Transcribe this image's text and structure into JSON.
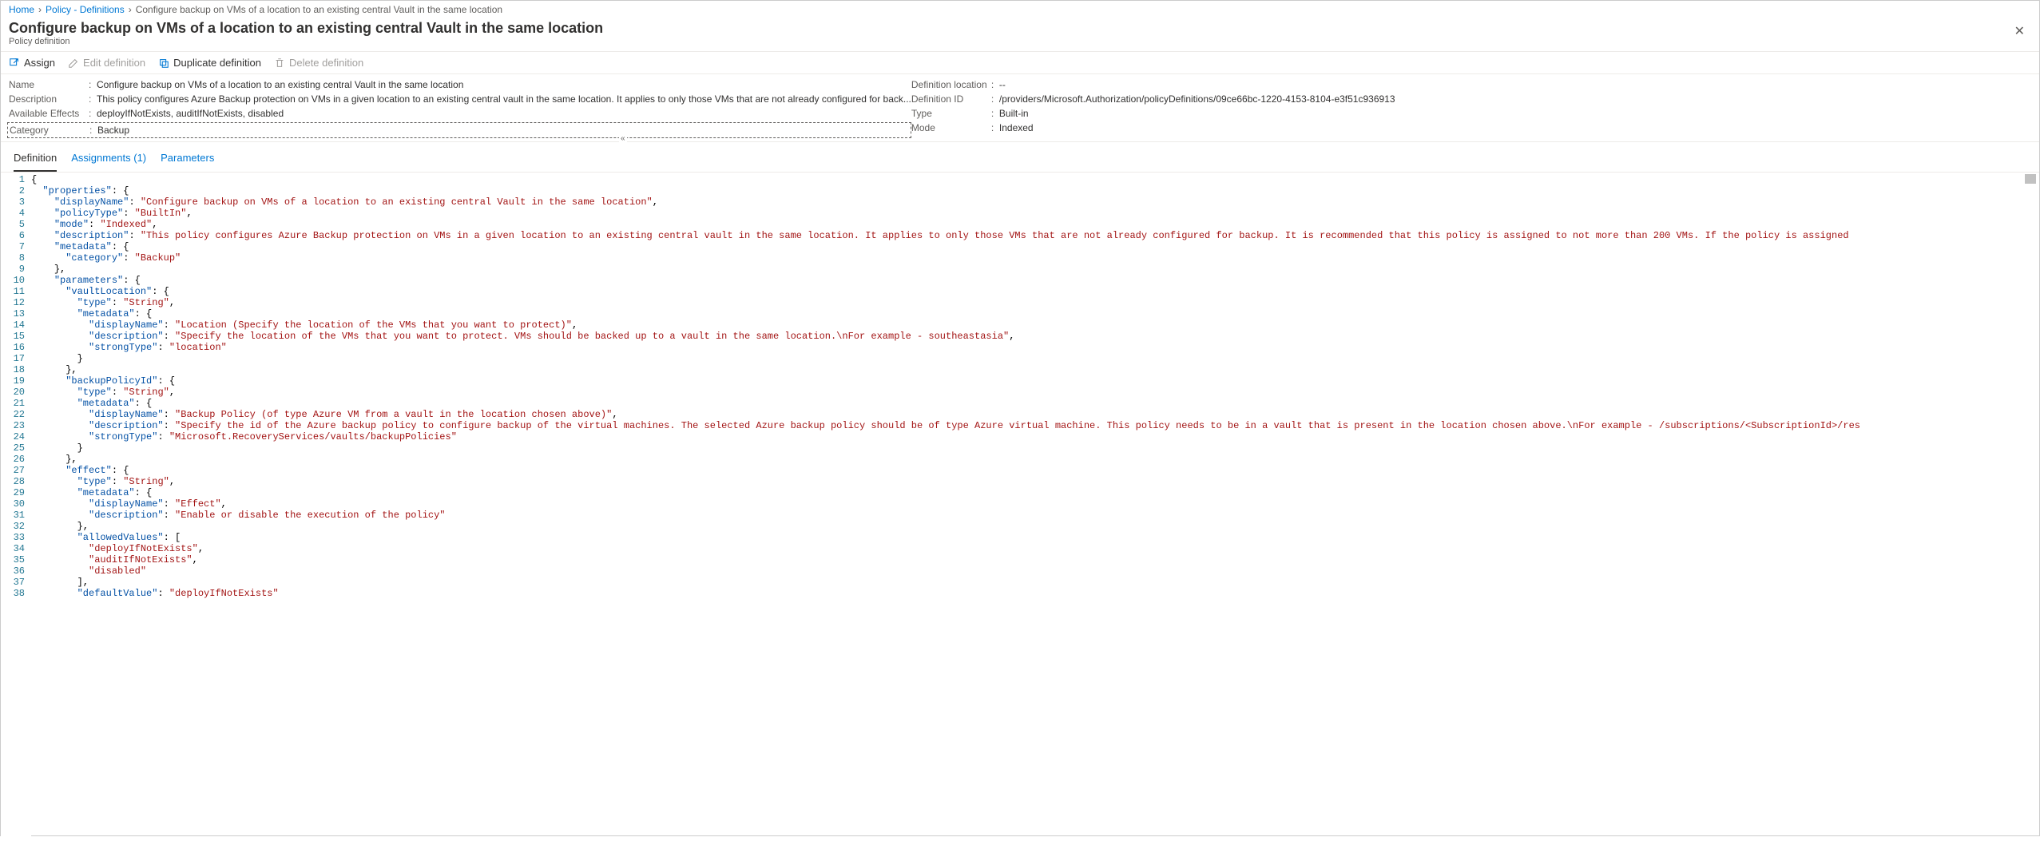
{
  "breadcrumb": {
    "items": [
      {
        "label": "Home",
        "link": true
      },
      {
        "label": "Policy - Definitions",
        "link": true
      },
      {
        "label": "Configure backup on VMs of a location to an existing central Vault in the same location",
        "link": false
      }
    ]
  },
  "title": {
    "heading": "Configure backup on VMs of a location to an existing central Vault in the same location",
    "subtitle": "Policy definition"
  },
  "toolbar": {
    "assign": "Assign",
    "edit": "Edit definition",
    "duplicate": "Duplicate definition",
    "delete": "Delete definition"
  },
  "essentials": {
    "left": [
      {
        "label": "Name",
        "value": "Configure backup on VMs of a location to an existing central Vault in the same location"
      },
      {
        "label": "Description",
        "value": "This policy configures Azure Backup protection on VMs in a given location to an existing central vault in the same location. It applies to only those VMs that are not already configured for back..."
      },
      {
        "label": "Available Effects",
        "value": "deployIfNotExists, auditIfNotExists, disabled"
      },
      {
        "label": "Category",
        "value": "Backup",
        "dashed": true
      }
    ],
    "right": [
      {
        "label": "Definition location",
        "value": "--"
      },
      {
        "label": "Definition ID",
        "value": "/providers/Microsoft.Authorization/policyDefinitions/09ce66bc-1220-4153-8104-e3f51c936913"
      },
      {
        "label": "Type",
        "value": "Built-in"
      },
      {
        "label": "Mode",
        "value": "Indexed"
      }
    ]
  },
  "tabs": {
    "definition": "Definition",
    "assignments": "Assignments (1)",
    "parameters": "Parameters"
  },
  "code": {
    "lines": [
      {
        "n": 1,
        "ind": 0,
        "t": [
          {
            "c": "brace",
            "v": "{"
          }
        ]
      },
      {
        "n": 2,
        "ind": 1,
        "t": [
          {
            "c": "key",
            "v": "\"properties\""
          },
          {
            "c": "punct",
            "v": ": {"
          }
        ]
      },
      {
        "n": 3,
        "ind": 2,
        "t": [
          {
            "c": "key",
            "v": "\"displayName\""
          },
          {
            "c": "punct",
            "v": ": "
          },
          {
            "c": "string",
            "v": "\"Configure backup on VMs of a location to an existing central Vault in the same location\""
          },
          {
            "c": "punct",
            "v": ","
          }
        ]
      },
      {
        "n": 4,
        "ind": 2,
        "t": [
          {
            "c": "key",
            "v": "\"policyType\""
          },
          {
            "c": "punct",
            "v": ": "
          },
          {
            "c": "string",
            "v": "\"BuiltIn\""
          },
          {
            "c": "punct",
            "v": ","
          }
        ]
      },
      {
        "n": 5,
        "ind": 2,
        "t": [
          {
            "c": "key",
            "v": "\"mode\""
          },
          {
            "c": "punct",
            "v": ": "
          },
          {
            "c": "string",
            "v": "\"Indexed\""
          },
          {
            "c": "punct",
            "v": ","
          }
        ]
      },
      {
        "n": 6,
        "ind": 2,
        "t": [
          {
            "c": "key",
            "v": "\"description\""
          },
          {
            "c": "punct",
            "v": ": "
          },
          {
            "c": "string",
            "v": "\"This policy configures Azure Backup protection on VMs in a given location to an existing central vault in the same location. It applies to only those VMs that are not already configured for backup. It is recommended that this policy is assigned to not more than 200 VMs. If the policy is assigned "
          }
        ]
      },
      {
        "n": 7,
        "ind": 2,
        "t": [
          {
            "c": "key",
            "v": "\"metadata\""
          },
          {
            "c": "punct",
            "v": ": {"
          }
        ]
      },
      {
        "n": 8,
        "ind": 3,
        "t": [
          {
            "c": "key",
            "v": "\"category\""
          },
          {
            "c": "punct",
            "v": ": "
          },
          {
            "c": "string",
            "v": "\"Backup\""
          }
        ]
      },
      {
        "n": 9,
        "ind": 2,
        "t": [
          {
            "c": "punct",
            "v": "},"
          }
        ]
      },
      {
        "n": 10,
        "ind": 2,
        "t": [
          {
            "c": "key",
            "v": "\"parameters\""
          },
          {
            "c": "punct",
            "v": ": {"
          }
        ]
      },
      {
        "n": 11,
        "ind": 3,
        "t": [
          {
            "c": "key",
            "v": "\"vaultLocation\""
          },
          {
            "c": "punct",
            "v": ": {"
          }
        ]
      },
      {
        "n": 12,
        "ind": 4,
        "t": [
          {
            "c": "key",
            "v": "\"type\""
          },
          {
            "c": "punct",
            "v": ": "
          },
          {
            "c": "string",
            "v": "\"String\""
          },
          {
            "c": "punct",
            "v": ","
          }
        ]
      },
      {
        "n": 13,
        "ind": 4,
        "t": [
          {
            "c": "key",
            "v": "\"metadata\""
          },
          {
            "c": "punct",
            "v": ": {"
          }
        ]
      },
      {
        "n": 14,
        "ind": 5,
        "t": [
          {
            "c": "key",
            "v": "\"displayName\""
          },
          {
            "c": "punct",
            "v": ": "
          },
          {
            "c": "string",
            "v": "\"Location (Specify the location of the VMs that you want to protect)\""
          },
          {
            "c": "punct",
            "v": ","
          }
        ]
      },
      {
        "n": 15,
        "ind": 5,
        "t": [
          {
            "c": "key",
            "v": "\"description\""
          },
          {
            "c": "punct",
            "v": ": "
          },
          {
            "c": "string",
            "v": "\"Specify the location of the VMs that you want to protect. VMs should be backed up to a vault in the same location.\\nFor example - southeastasia\""
          },
          {
            "c": "punct",
            "v": ","
          }
        ]
      },
      {
        "n": 16,
        "ind": 5,
        "t": [
          {
            "c": "key",
            "v": "\"strongType\""
          },
          {
            "c": "punct",
            "v": ": "
          },
          {
            "c": "string",
            "v": "\"location\""
          }
        ]
      },
      {
        "n": 17,
        "ind": 4,
        "t": [
          {
            "c": "punct",
            "v": "}"
          }
        ]
      },
      {
        "n": 18,
        "ind": 3,
        "t": [
          {
            "c": "punct",
            "v": "},"
          }
        ]
      },
      {
        "n": 19,
        "ind": 3,
        "t": [
          {
            "c": "key",
            "v": "\"backupPolicyId\""
          },
          {
            "c": "punct",
            "v": ": {"
          }
        ]
      },
      {
        "n": 20,
        "ind": 4,
        "t": [
          {
            "c": "key",
            "v": "\"type\""
          },
          {
            "c": "punct",
            "v": ": "
          },
          {
            "c": "string",
            "v": "\"String\""
          },
          {
            "c": "punct",
            "v": ","
          }
        ]
      },
      {
        "n": 21,
        "ind": 4,
        "t": [
          {
            "c": "key",
            "v": "\"metadata\""
          },
          {
            "c": "punct",
            "v": ": {"
          }
        ]
      },
      {
        "n": 22,
        "ind": 5,
        "t": [
          {
            "c": "key",
            "v": "\"displayName\""
          },
          {
            "c": "punct",
            "v": ": "
          },
          {
            "c": "string",
            "v": "\"Backup Policy (of type Azure VM from a vault in the location chosen above)\""
          },
          {
            "c": "punct",
            "v": ","
          }
        ]
      },
      {
        "n": 23,
        "ind": 5,
        "t": [
          {
            "c": "key",
            "v": "\"description\""
          },
          {
            "c": "punct",
            "v": ": "
          },
          {
            "c": "string",
            "v": "\"Specify the id of the Azure backup policy to configure backup of the virtual machines. The selected Azure backup policy should be of type Azure virtual machine. This policy needs to be in a vault that is present in the location chosen above.\\nFor example - /subscriptions/<SubscriptionId>/res"
          }
        ]
      },
      {
        "n": 24,
        "ind": 5,
        "t": [
          {
            "c": "key",
            "v": "\"strongType\""
          },
          {
            "c": "punct",
            "v": ": "
          },
          {
            "c": "string",
            "v": "\"Microsoft.RecoveryServices/vaults/backupPolicies\""
          }
        ]
      },
      {
        "n": 25,
        "ind": 4,
        "t": [
          {
            "c": "punct",
            "v": "}"
          }
        ]
      },
      {
        "n": 26,
        "ind": 3,
        "t": [
          {
            "c": "punct",
            "v": "},"
          }
        ]
      },
      {
        "n": 27,
        "ind": 3,
        "t": [
          {
            "c": "key",
            "v": "\"effect\""
          },
          {
            "c": "punct",
            "v": ": {"
          }
        ]
      },
      {
        "n": 28,
        "ind": 4,
        "t": [
          {
            "c": "key",
            "v": "\"type\""
          },
          {
            "c": "punct",
            "v": ": "
          },
          {
            "c": "string",
            "v": "\"String\""
          },
          {
            "c": "punct",
            "v": ","
          }
        ]
      },
      {
        "n": 29,
        "ind": 4,
        "t": [
          {
            "c": "key",
            "v": "\"metadata\""
          },
          {
            "c": "punct",
            "v": ": {"
          }
        ]
      },
      {
        "n": 30,
        "ind": 5,
        "t": [
          {
            "c": "key",
            "v": "\"displayName\""
          },
          {
            "c": "punct",
            "v": ": "
          },
          {
            "c": "string",
            "v": "\"Effect\""
          },
          {
            "c": "punct",
            "v": ","
          }
        ]
      },
      {
        "n": 31,
        "ind": 5,
        "t": [
          {
            "c": "key",
            "v": "\"description\""
          },
          {
            "c": "punct",
            "v": ": "
          },
          {
            "c": "string",
            "v": "\"Enable or disable the execution of the policy\""
          }
        ]
      },
      {
        "n": 32,
        "ind": 4,
        "t": [
          {
            "c": "punct",
            "v": "},"
          }
        ]
      },
      {
        "n": 33,
        "ind": 4,
        "t": [
          {
            "c": "key",
            "v": "\"allowedValues\""
          },
          {
            "c": "punct",
            "v": ": ["
          }
        ]
      },
      {
        "n": 34,
        "ind": 5,
        "t": [
          {
            "c": "string",
            "v": "\"deployIfNotExists\""
          },
          {
            "c": "punct",
            "v": ","
          }
        ]
      },
      {
        "n": 35,
        "ind": 5,
        "t": [
          {
            "c": "string",
            "v": "\"auditIfNotExists\""
          },
          {
            "c": "punct",
            "v": ","
          }
        ]
      },
      {
        "n": 36,
        "ind": 5,
        "t": [
          {
            "c": "string",
            "v": "\"disabled\""
          }
        ]
      },
      {
        "n": 37,
        "ind": 4,
        "t": [
          {
            "c": "punct",
            "v": "],"
          }
        ]
      },
      {
        "n": 38,
        "ind": 4,
        "t": [
          {
            "c": "key",
            "v": "\"defaultValue\""
          },
          {
            "c": "punct",
            "v": ": "
          },
          {
            "c": "string",
            "v": "\"deployIfNotExists\""
          }
        ]
      }
    ]
  }
}
